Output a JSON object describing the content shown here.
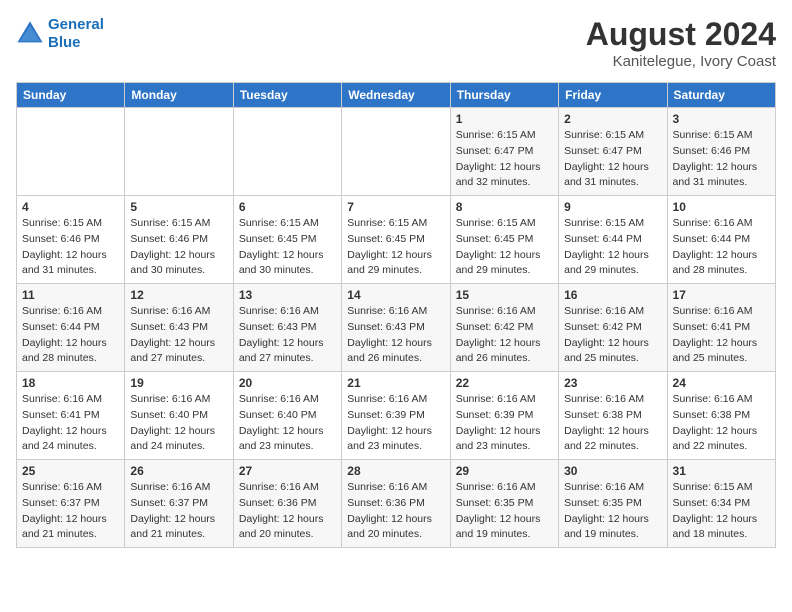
{
  "app": {
    "name_line1": "General",
    "name_line2": "Blue"
  },
  "title": "August 2024",
  "subtitle": "Kanitelegue, Ivory Coast",
  "days_of_week": [
    "Sunday",
    "Monday",
    "Tuesday",
    "Wednesday",
    "Thursday",
    "Friday",
    "Saturday"
  ],
  "weeks": [
    [
      {
        "day": "",
        "info": ""
      },
      {
        "day": "",
        "info": ""
      },
      {
        "day": "",
        "info": ""
      },
      {
        "day": "",
        "info": ""
      },
      {
        "day": "1",
        "info": "Sunrise: 6:15 AM\nSunset: 6:47 PM\nDaylight: 12 hours\nand 32 minutes."
      },
      {
        "day": "2",
        "info": "Sunrise: 6:15 AM\nSunset: 6:47 PM\nDaylight: 12 hours\nand 31 minutes."
      },
      {
        "day": "3",
        "info": "Sunrise: 6:15 AM\nSunset: 6:46 PM\nDaylight: 12 hours\nand 31 minutes."
      }
    ],
    [
      {
        "day": "4",
        "info": "Sunrise: 6:15 AM\nSunset: 6:46 PM\nDaylight: 12 hours\nand 31 minutes."
      },
      {
        "day": "5",
        "info": "Sunrise: 6:15 AM\nSunset: 6:46 PM\nDaylight: 12 hours\nand 30 minutes."
      },
      {
        "day": "6",
        "info": "Sunrise: 6:15 AM\nSunset: 6:45 PM\nDaylight: 12 hours\nand 30 minutes."
      },
      {
        "day": "7",
        "info": "Sunrise: 6:15 AM\nSunset: 6:45 PM\nDaylight: 12 hours\nand 29 minutes."
      },
      {
        "day": "8",
        "info": "Sunrise: 6:15 AM\nSunset: 6:45 PM\nDaylight: 12 hours\nand 29 minutes."
      },
      {
        "day": "9",
        "info": "Sunrise: 6:15 AM\nSunset: 6:44 PM\nDaylight: 12 hours\nand 29 minutes."
      },
      {
        "day": "10",
        "info": "Sunrise: 6:16 AM\nSunset: 6:44 PM\nDaylight: 12 hours\nand 28 minutes."
      }
    ],
    [
      {
        "day": "11",
        "info": "Sunrise: 6:16 AM\nSunset: 6:44 PM\nDaylight: 12 hours\nand 28 minutes."
      },
      {
        "day": "12",
        "info": "Sunrise: 6:16 AM\nSunset: 6:43 PM\nDaylight: 12 hours\nand 27 minutes."
      },
      {
        "day": "13",
        "info": "Sunrise: 6:16 AM\nSunset: 6:43 PM\nDaylight: 12 hours\nand 27 minutes."
      },
      {
        "day": "14",
        "info": "Sunrise: 6:16 AM\nSunset: 6:43 PM\nDaylight: 12 hours\nand 26 minutes."
      },
      {
        "day": "15",
        "info": "Sunrise: 6:16 AM\nSunset: 6:42 PM\nDaylight: 12 hours\nand 26 minutes."
      },
      {
        "day": "16",
        "info": "Sunrise: 6:16 AM\nSunset: 6:42 PM\nDaylight: 12 hours\nand 25 minutes."
      },
      {
        "day": "17",
        "info": "Sunrise: 6:16 AM\nSunset: 6:41 PM\nDaylight: 12 hours\nand 25 minutes."
      }
    ],
    [
      {
        "day": "18",
        "info": "Sunrise: 6:16 AM\nSunset: 6:41 PM\nDaylight: 12 hours\nand 24 minutes."
      },
      {
        "day": "19",
        "info": "Sunrise: 6:16 AM\nSunset: 6:40 PM\nDaylight: 12 hours\nand 24 minutes."
      },
      {
        "day": "20",
        "info": "Sunrise: 6:16 AM\nSunset: 6:40 PM\nDaylight: 12 hours\nand 23 minutes."
      },
      {
        "day": "21",
        "info": "Sunrise: 6:16 AM\nSunset: 6:39 PM\nDaylight: 12 hours\nand 23 minutes."
      },
      {
        "day": "22",
        "info": "Sunrise: 6:16 AM\nSunset: 6:39 PM\nDaylight: 12 hours\nand 23 minutes."
      },
      {
        "day": "23",
        "info": "Sunrise: 6:16 AM\nSunset: 6:38 PM\nDaylight: 12 hours\nand 22 minutes."
      },
      {
        "day": "24",
        "info": "Sunrise: 6:16 AM\nSunset: 6:38 PM\nDaylight: 12 hours\nand 22 minutes."
      }
    ],
    [
      {
        "day": "25",
        "info": "Sunrise: 6:16 AM\nSunset: 6:37 PM\nDaylight: 12 hours\nand 21 minutes."
      },
      {
        "day": "26",
        "info": "Sunrise: 6:16 AM\nSunset: 6:37 PM\nDaylight: 12 hours\nand 21 minutes."
      },
      {
        "day": "27",
        "info": "Sunrise: 6:16 AM\nSunset: 6:36 PM\nDaylight: 12 hours\nand 20 minutes."
      },
      {
        "day": "28",
        "info": "Sunrise: 6:16 AM\nSunset: 6:36 PM\nDaylight: 12 hours\nand 20 minutes."
      },
      {
        "day": "29",
        "info": "Sunrise: 6:16 AM\nSunset: 6:35 PM\nDaylight: 12 hours\nand 19 minutes."
      },
      {
        "day": "30",
        "info": "Sunrise: 6:16 AM\nSunset: 6:35 PM\nDaylight: 12 hours\nand 19 minutes."
      },
      {
        "day": "31",
        "info": "Sunrise: 6:15 AM\nSunset: 6:34 PM\nDaylight: 12 hours\nand 18 minutes."
      }
    ]
  ]
}
